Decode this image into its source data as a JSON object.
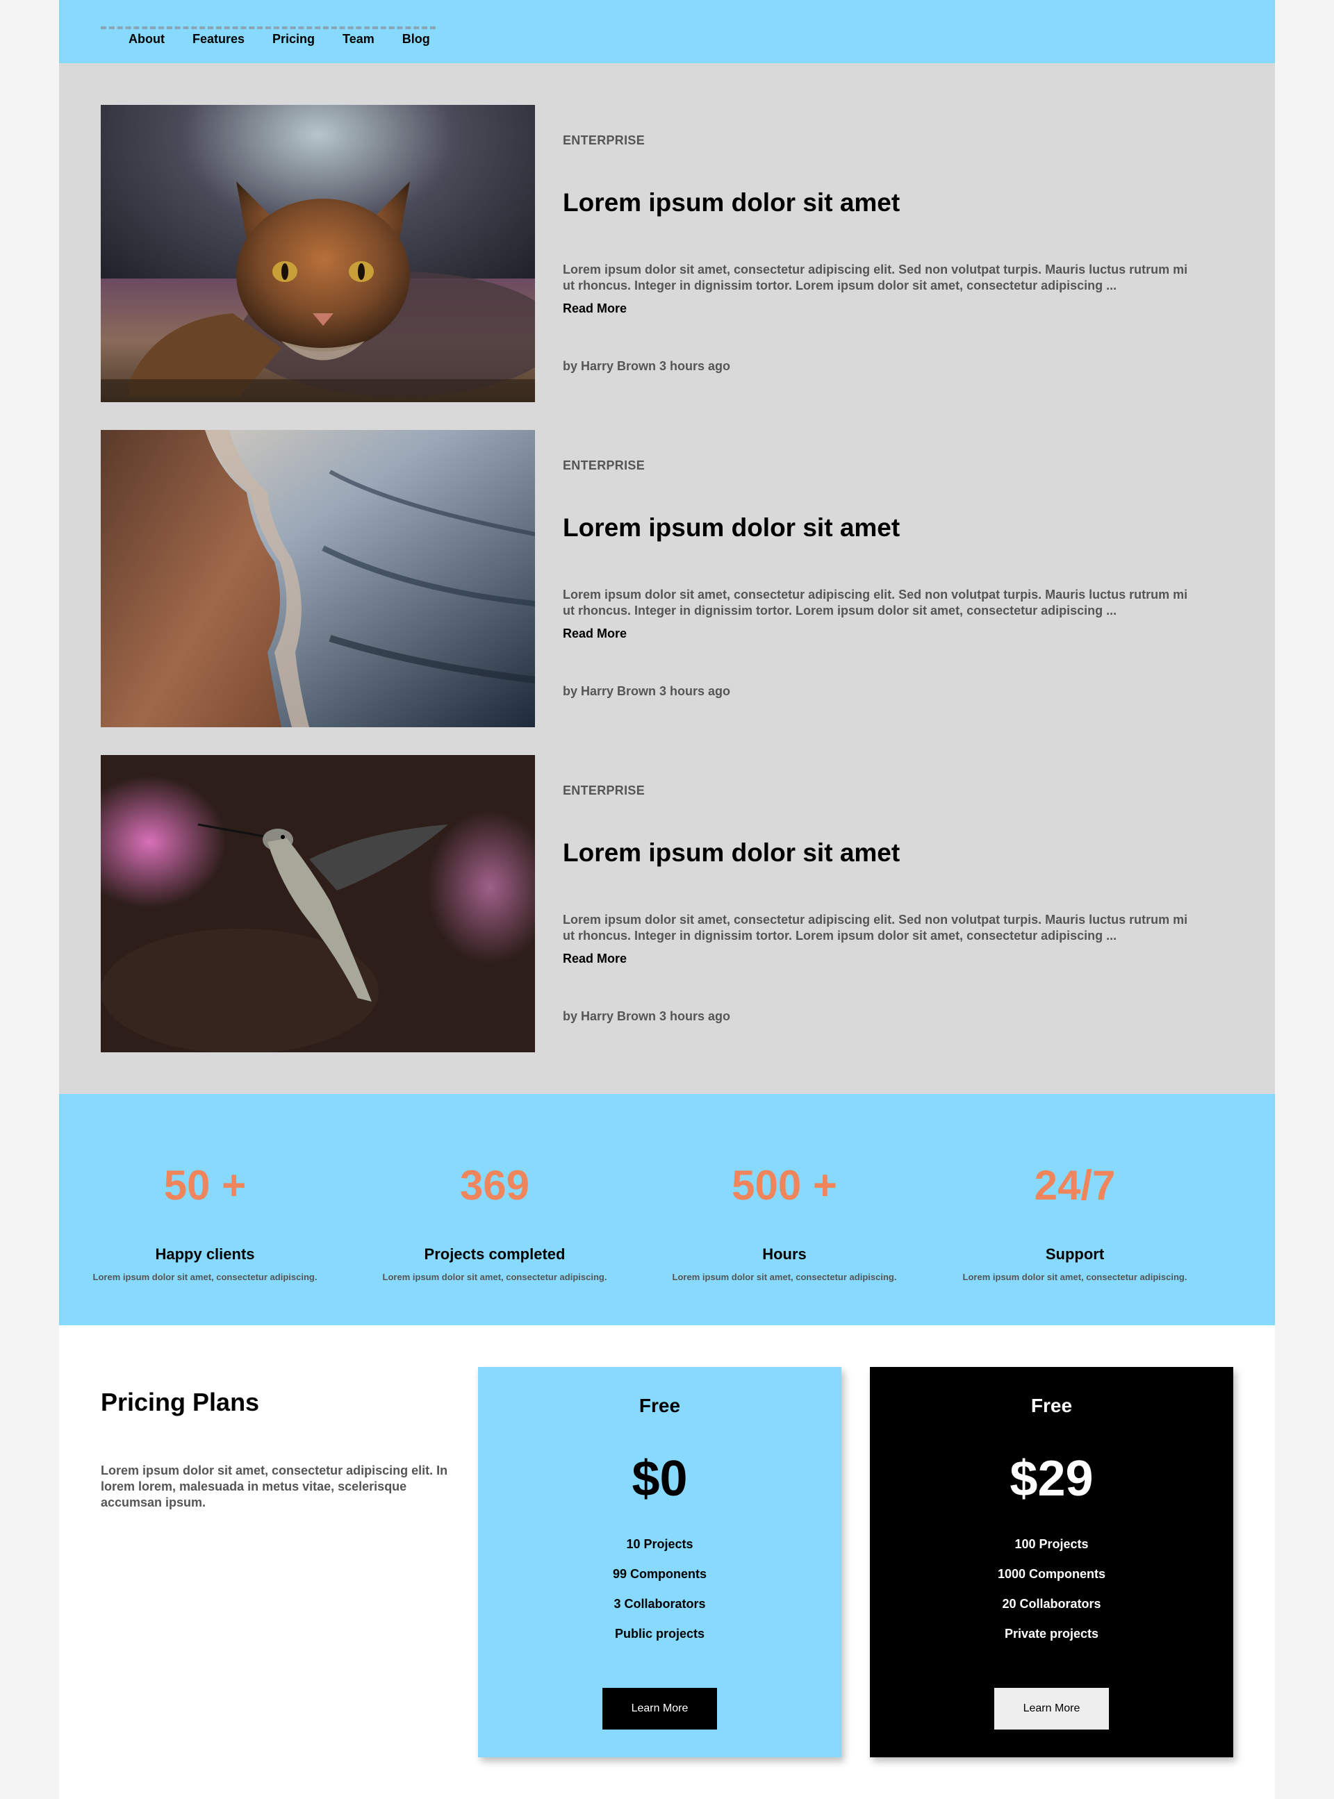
{
  "nav": {
    "items": [
      "About",
      "Features",
      "Pricing",
      "Team",
      "Blog"
    ]
  },
  "articles": [
    {
      "image": "cat-photo",
      "tag": "ENTERPRISE",
      "title": "Lorem ipsum dolor sit amet",
      "excerpt": "Lorem ipsum dolor sit amet, consectetur adipiscing elit. Sed non volutpat turpis. Mauris luctus rutrum mi ut rhoncus. Integer in dignissim tortor. Lorem ipsum dolor sit amet, consectetur adipiscing ...",
      "read_more": "Read More",
      "byline": "by Harry Brown 3 hours ago"
    },
    {
      "image": "beach-photo",
      "tag": "ENTERPRISE",
      "title": "Lorem ipsum dolor sit amet",
      "excerpt": "Lorem ipsum dolor sit amet, consectetur adipiscing elit. Sed non volutpat turpis. Mauris luctus rutrum mi ut rhoncus. Integer in dignissim tortor. Lorem ipsum dolor sit amet, consectetur adipiscing ...",
      "read_more": "Read More",
      "byline": "by Harry Brown 3 hours ago"
    },
    {
      "image": "hummingbird-photo",
      "tag": "ENTERPRISE",
      "title": "Lorem ipsum dolor sit amet",
      "excerpt": "Lorem ipsum dolor sit amet, consectetur adipiscing elit. Sed non volutpat turpis. Mauris luctus rutrum mi ut rhoncus. Integer in dignissim tortor. Lorem ipsum dolor sit amet, consectetur adipiscing ...",
      "read_more": "Read More",
      "byline": "by Harry Brown 3 hours ago"
    }
  ],
  "stats": [
    {
      "number": "50 +",
      "label": "Happy clients",
      "desc": "Lorem ipsum dolor sit amet, consectetur adipiscing."
    },
    {
      "number": "369",
      "label": "Projects completed",
      "desc": "Lorem ipsum dolor sit amet, consectetur adipiscing."
    },
    {
      "number": "500 +",
      "label": "Hours",
      "desc": "Lorem ipsum dolor sit amet, consectetur adipiscing."
    },
    {
      "number": "24/7",
      "label": "Support",
      "desc": "Lorem ipsum dolor sit amet, consectetur adipiscing."
    }
  ],
  "pricing": {
    "title": "Pricing Plans",
    "intro": "Lorem ipsum dolor sit amet, consectetur adipiscing elit. In lorem lorem, malesuada in metus vitae, scelerisque accumsan ipsum.",
    "plans": [
      {
        "name": "Free",
        "price": "$0",
        "features": [
          "10 Projects",
          "99 Components",
          "3 Collaborators",
          "Public projects"
        ],
        "button": "Learn More"
      },
      {
        "name": "Free",
        "price": "$29",
        "features": [
          "100 Projects",
          "1000 Components",
          "20 Collaborators",
          "Private projects"
        ],
        "button": "Learn More"
      }
    ]
  },
  "colors": {
    "accent_blue": "#87dafe",
    "stat_orange": "#f0845b",
    "article_bg": "#d9d9d9",
    "page_bg": "#f4f4f4"
  }
}
